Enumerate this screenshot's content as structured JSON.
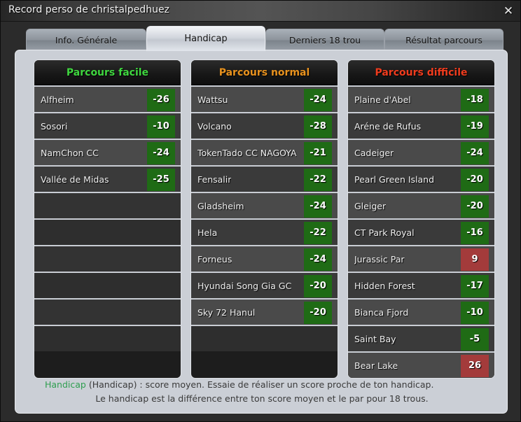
{
  "window": {
    "title": "Record perso de christalpedhuez",
    "close_icon": "close-icon",
    "close_glyph": "✕"
  },
  "tabs": [
    {
      "label": "Info. Générale",
      "active": false
    },
    {
      "label": "Handicap",
      "active": true
    },
    {
      "label": "Derniers 18 trou",
      "active": false
    },
    {
      "label": "Résultat parcours",
      "active": false
    }
  ],
  "colors": {
    "easy": "#3fd63f",
    "normal": "#e8921e",
    "hard": "#f03c1e",
    "badge_negative": "#1f6b15",
    "badge_positive": "#a33b3b",
    "panel": "#cbcfd6",
    "footer_highlight": "#2e9e4f"
  },
  "columns": [
    {
      "title": "Parcours facile",
      "rows": [
        {
          "name": "Alfheim",
          "value": "-26",
          "sign": "neg"
        },
        {
          "name": "Sosori",
          "value": "-10",
          "sign": "neg"
        },
        {
          "name": "NamChon CC",
          "value": "-24",
          "sign": "neg"
        },
        {
          "name": "Vallée de Midas",
          "value": "-25",
          "sign": "neg"
        },
        {
          "name": "",
          "value": "",
          "sign": ""
        },
        {
          "name": "",
          "value": "",
          "sign": ""
        },
        {
          "name": "",
          "value": "",
          "sign": ""
        },
        {
          "name": "",
          "value": "",
          "sign": ""
        },
        {
          "name": "",
          "value": "",
          "sign": ""
        },
        {
          "name": "",
          "value": "",
          "sign": ""
        }
      ]
    },
    {
      "title": "Parcours normal",
      "rows": [
        {
          "name": "Wattsu",
          "value": "-24",
          "sign": "neg"
        },
        {
          "name": "Volcano",
          "value": "-28",
          "sign": "neg"
        },
        {
          "name": "TokenTado CC NAGOYA",
          "value": "-21",
          "sign": "neg"
        },
        {
          "name": "Fensalir",
          "value": "-22",
          "sign": "neg"
        },
        {
          "name": "Gladsheim",
          "value": "-24",
          "sign": "neg"
        },
        {
          "name": "Hela",
          "value": "-22",
          "sign": "neg"
        },
        {
          "name": "Forneus",
          "value": "-24",
          "sign": "neg"
        },
        {
          "name": "Hyundai Song Gia GC",
          "value": "-20",
          "sign": "neg"
        },
        {
          "name": "Sky 72 Hanul",
          "value": "-20",
          "sign": "neg"
        },
        {
          "name": "",
          "value": "",
          "sign": ""
        }
      ]
    },
    {
      "title": "Parcours difficile",
      "rows": [
        {
          "name": "Plaine d'Abel",
          "value": "-18",
          "sign": "neg"
        },
        {
          "name": "Aréne de Rufus",
          "value": "-19",
          "sign": "neg"
        },
        {
          "name": "Cadeiger",
          "value": "-24",
          "sign": "neg"
        },
        {
          "name": "Pearl Green Island",
          "value": "-20",
          "sign": "neg"
        },
        {
          "name": "Gleiger",
          "value": "-20",
          "sign": "neg"
        },
        {
          "name": "CT Park Royal",
          "value": "-16",
          "sign": "neg"
        },
        {
          "name": "Jurassic Par",
          "value": "9",
          "sign": "pos"
        },
        {
          "name": "Hidden Forest",
          "value": "-17",
          "sign": "neg"
        },
        {
          "name": "Bianca Fjord",
          "value": "-10",
          "sign": "neg"
        },
        {
          "name": "Saint Bay",
          "value": "-5",
          "sign": "neg"
        },
        {
          "name": "Bear Lake",
          "value": "26",
          "sign": "pos"
        }
      ]
    }
  ],
  "footer": {
    "highlight": "Handicap",
    "line1_rest": " (Handicap) : score moyen. Essaie de réaliser un score proche de ton handicap.",
    "line2": "Le handicap est la différence entre ton score moyen et le par pour 18 trous."
  }
}
